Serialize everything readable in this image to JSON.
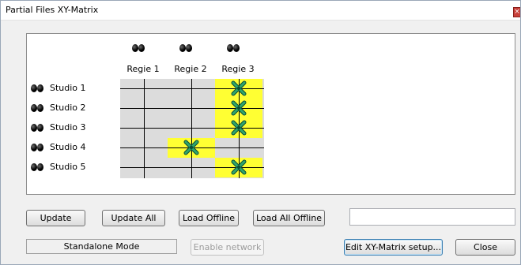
{
  "window": {
    "title": "Partial Files XY-Matrix",
    "close_glyph": "×"
  },
  "matrix": {
    "columns": [
      "Regie 1",
      "Regie 2",
      "Regie 3"
    ],
    "rows": [
      "Studio 1",
      "Studio 2",
      "Studio 3",
      "Studio 4",
      "Studio 5"
    ],
    "connections": [
      {
        "row": "Studio 1",
        "column": "Regie 3"
      },
      {
        "row": "Studio 2",
        "column": "Regie 3"
      },
      {
        "row": "Studio 3",
        "column": "Regie 3"
      },
      {
        "row": "Studio 4",
        "column": "Regie 2"
      },
      {
        "row": "Studio 5",
        "column": "Regie 3"
      }
    ],
    "highlight_color": "#ffff33",
    "grid_color": "#dcdcdc",
    "icons": {
      "node": "eyes-icon",
      "connection": "cross-connection-icon"
    }
  },
  "buttons": {
    "update": "Update",
    "update_all": "Update All",
    "load_offline": "Load Offline",
    "load_all_offline": "Load All Offline",
    "enable_network": "Enable network",
    "edit_setup": "Edit XY-Matrix setup...",
    "close": "Close"
  },
  "status": {
    "mode": "Standalone Mode"
  },
  "input": {
    "value": ""
  }
}
